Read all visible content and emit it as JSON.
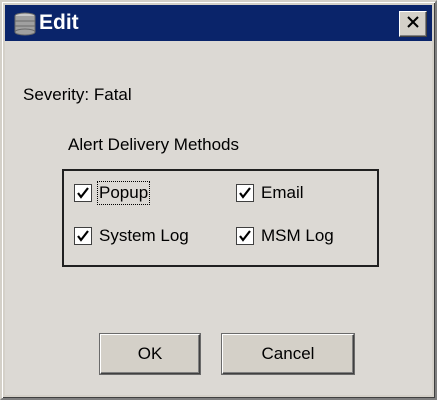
{
  "window": {
    "title": "Edit",
    "title_icon": "database-icon",
    "close_icon": "close-icon"
  },
  "severity_text": "Severity: Fatal",
  "alert_group": {
    "title": "Alert Delivery Methods",
    "options": [
      {
        "label": "Popup",
        "checked": true
      },
      {
        "label": "Email",
        "checked": true
      },
      {
        "label": "System Log",
        "checked": true
      },
      {
        "label": "MSM Log",
        "checked": true
      }
    ]
  },
  "buttons": {
    "ok_label": "OK",
    "cancel_label": "Cancel"
  },
  "colors": {
    "titlebar": "#0a246a",
    "dialog_bg": "#d4d0c8"
  }
}
